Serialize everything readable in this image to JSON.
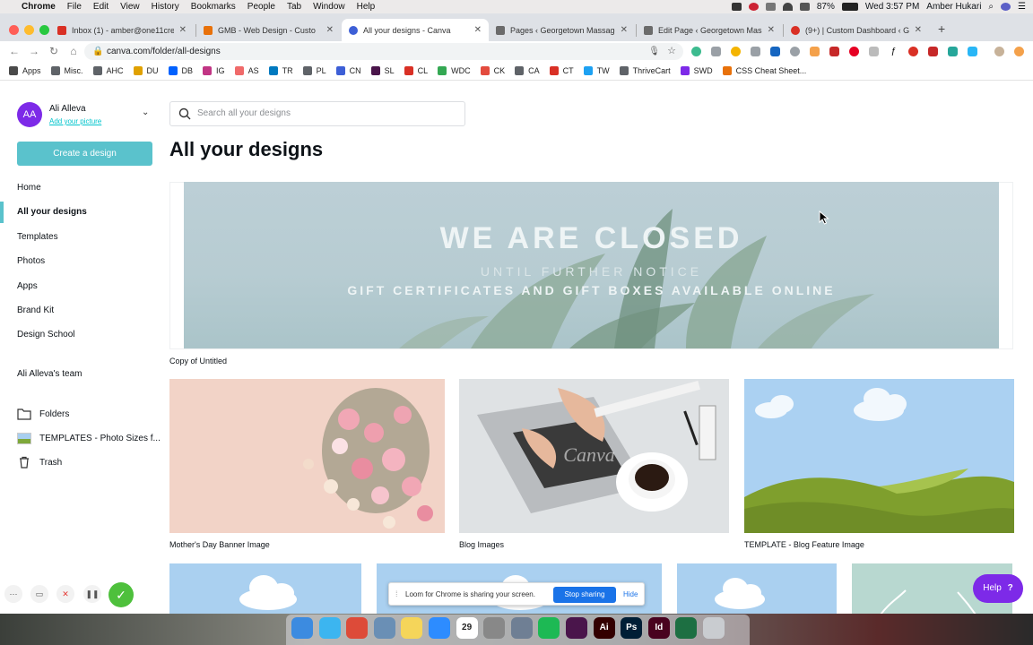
{
  "menubar": {
    "app": "Chrome",
    "menus": [
      "File",
      "Edit",
      "View",
      "History",
      "Bookmarks",
      "People",
      "Tab",
      "Window",
      "Help"
    ],
    "battery": "87%",
    "datetime": "Wed 3:57 PM",
    "user": "Amber Hukari"
  },
  "tabs": [
    {
      "label": "Inbox (1) - amber@one11creati",
      "color": "#d93025"
    },
    {
      "label": "GMB - Web Design - Custo",
      "color": "#e8710a"
    },
    {
      "label": "All your designs - Canva",
      "color": "#3d5fd6"
    },
    {
      "label": "Pages ‹ Georgetown Massage",
      "color": "#6b6b6b"
    },
    {
      "label": "Edit Page ‹ Georgetown Massa",
      "color": "#6b6b6b"
    },
    {
      "label": "(9+) | Custom Dashboard ‹ Ge",
      "color": "#d93025"
    }
  ],
  "address": {
    "url": "canva.com/folder/all-designs"
  },
  "bookmarks": [
    {
      "label": "Apps",
      "color": "#4a4a4a"
    },
    {
      "label": "Misc.",
      "color": "#5f6368"
    },
    {
      "label": "AHC",
      "color": "#5f6368"
    },
    {
      "label": "DU",
      "color": "#e0a100"
    },
    {
      "label": "DB",
      "color": "#0061fe"
    },
    {
      "label": "IG",
      "color": "#c13584"
    },
    {
      "label": "AS",
      "color": "#f06a6a"
    },
    {
      "label": "TR",
      "color": "#0079bf"
    },
    {
      "label": "PL",
      "color": "#5f6368"
    },
    {
      "label": "CN",
      "color": "#3d5fd6"
    },
    {
      "label": "SL",
      "color": "#4a154b"
    },
    {
      "label": "CL",
      "color": "#d93025"
    },
    {
      "label": "WDC",
      "color": "#34a853"
    },
    {
      "label": "CK",
      "color": "#e34b3e"
    },
    {
      "label": "CA",
      "color": "#5f6368"
    },
    {
      "label": "CT",
      "color": "#d93025"
    },
    {
      "label": "TW",
      "color": "#1da1f2"
    },
    {
      "label": "ThriveCart",
      "color": "#5f6368"
    },
    {
      "label": "SWD",
      "color": "#7d2ae8"
    },
    {
      "label": "CSS Cheat Sheet...",
      "color": "#e8710a"
    }
  ],
  "sidebar": {
    "avatar_initials": "AA",
    "user_name": "Ali Alleva",
    "add_picture": "Add your picture",
    "create_label": "Create a design",
    "nav": [
      "Home",
      "All your designs",
      "Templates",
      "Photos",
      "Apps",
      "Brand Kit",
      "Design School"
    ],
    "team": "Ali Alleva's team",
    "folders": "Folders",
    "templates_folder": "TEMPLATES - Photo Sizes f...",
    "trash": "Trash"
  },
  "main": {
    "search_placeholder": "Search all your designs",
    "title": "All your designs",
    "banner": {
      "line1": "WE ARE CLOSED",
      "line2": "UNTIL FURTHER NOTICE",
      "line3": "GIFT CERTIFICATES AND GIFT BOXES AVAILABLE ONLINE",
      "caption": "Copy of Untitled"
    },
    "designs": [
      {
        "caption": "Mother's Day Banner Image"
      },
      {
        "caption": "Blog Images",
        "watermark": "Canva"
      },
      {
        "caption": "TEMPLATE - Blog Feature Image"
      }
    ]
  },
  "help": {
    "label": "Help",
    "glyph": "?"
  },
  "loom": {
    "message": "Loom for Chrome is sharing your screen.",
    "stop_label": "Stop sharing",
    "hide_label": "Hide"
  },
  "dock": {
    "calendar_day": "29",
    "apps": [
      {
        "name": "Finder",
        "color": "#3c8be0"
      },
      {
        "name": "Messages",
        "color": "#3cb5f0"
      },
      {
        "name": "Chrome",
        "color": "#dd4b39"
      },
      {
        "name": "Preview",
        "color": "#6a8fb5"
      },
      {
        "name": "Notes",
        "color": "#f5d55a"
      },
      {
        "name": "Zoom",
        "color": "#2d8cff"
      },
      {
        "name": "Calendar",
        "color": "#ffffff"
      },
      {
        "name": "Screenshot",
        "color": "#888888"
      },
      {
        "name": "Launchpad",
        "color": "#6f7f94"
      },
      {
        "name": "Spotify",
        "color": "#1db954"
      },
      {
        "name": "Slack",
        "color": "#4a154b"
      },
      {
        "name": "Illustrator",
        "color": "#330000",
        "glyph": "Ai"
      },
      {
        "name": "Photoshop",
        "color": "#001e36",
        "glyph": "Ps"
      },
      {
        "name": "InDesign",
        "color": "#49021f",
        "glyph": "Id"
      },
      {
        "name": "Excel",
        "color": "#1d6f42"
      },
      {
        "name": "Trash",
        "color": "#c9ccd0"
      }
    ]
  }
}
